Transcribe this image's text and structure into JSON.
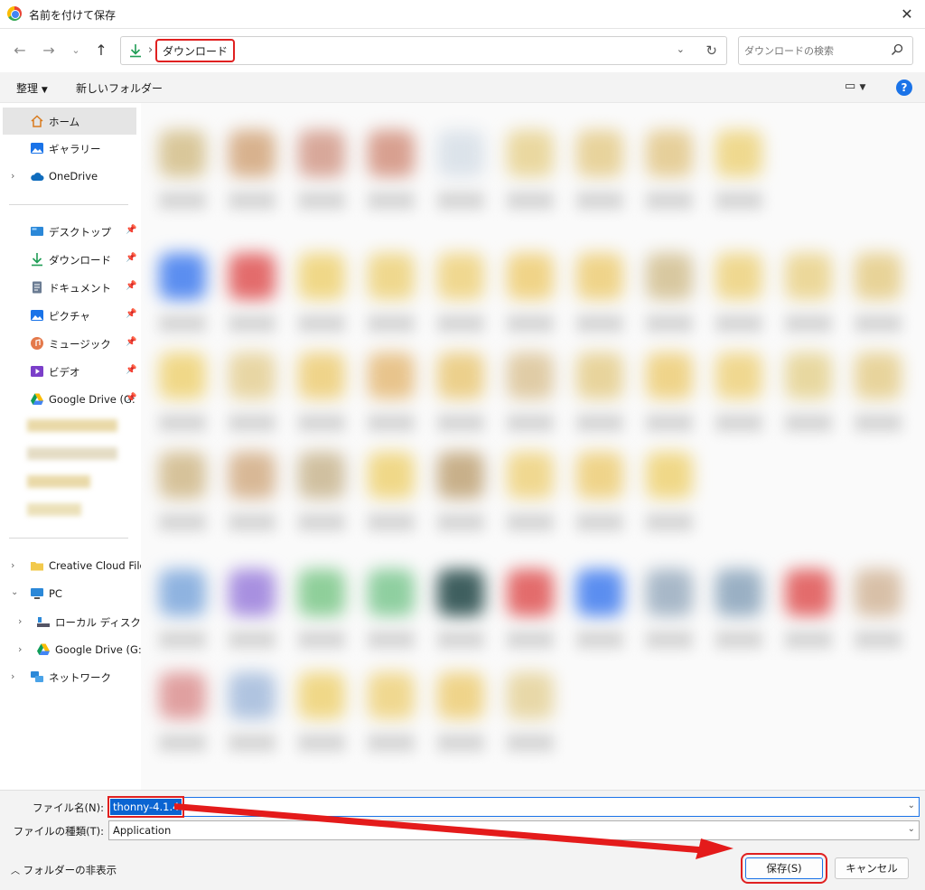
{
  "window": {
    "title": "名前を付けて保存"
  },
  "navigation": {
    "breadcrumb": "ダウンロード",
    "search_placeholder": "ダウンロードの検索"
  },
  "toolbar": {
    "organize": "整理",
    "new_folder": "新しいフォルダー"
  },
  "sidebar": {
    "home": "ホーム",
    "gallery": "ギャラリー",
    "onedrive": "OneDrive",
    "desktop": "デスクトップ",
    "downloads": "ダウンロード",
    "documents": "ドキュメント",
    "pictures": "ピクチャ",
    "music": "ミュージック",
    "videos": "ビデオ",
    "gdrive_pinned": "Google Drive (G:",
    "creative_cloud": "Creative Cloud Files",
    "pc": "PC",
    "local_disk": "ローカル ディスク (C:)",
    "gdrive": "Google Drive (G:)",
    "network": "ネットワーク"
  },
  "form": {
    "filename_label": "ファイル名(N):",
    "filename_value": "thonny-4.1.4",
    "filetype_label": "ファイルの種類(T):",
    "filetype_value": "Application"
  },
  "footer": {
    "hide_folders": "フォルダーの非表示",
    "save": "保存(S)",
    "cancel": "キャンセル"
  },
  "colors": {
    "accent": "#1a73e8",
    "highlight": "#e02020",
    "selection": "#0a64d2"
  }
}
